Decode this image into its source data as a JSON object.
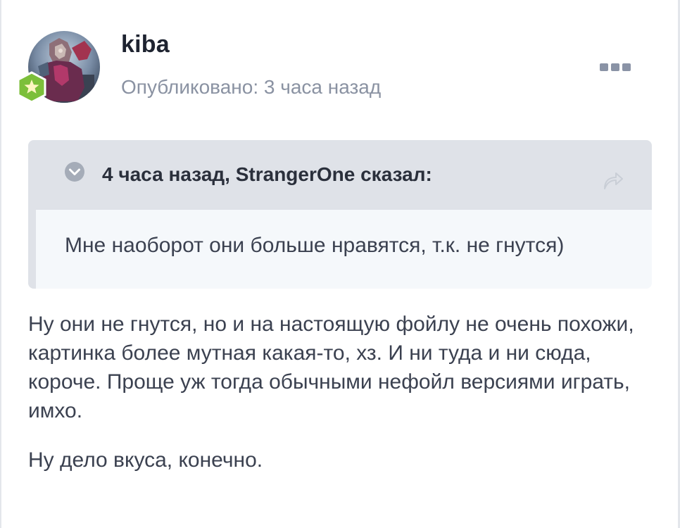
{
  "post": {
    "author": "kiba",
    "published": "Опубликовано: 3 часа назад",
    "avatar": "author-avatar",
    "rank_badge": "star-badge-icon",
    "more": "more-options-icon"
  },
  "quote": {
    "citation": "4 часа назад, StrangerOne сказал:",
    "body": "Мне наоборот они больше нравятся, т.к. не гнутся)",
    "collapse_icon": "chevron-down-circle-icon",
    "share_icon": "share-arrow-icon"
  },
  "body": {
    "paragraphs": [
      "Ну они не гнутся, но и на настоящую фойлу не очень похожи, картинка более мутная какая-то, хз. И ни туда и ни сюда, короче. Проще уж тогда обычными нефойл версиями играть, имхо.",
      "Ну дело вкуса, конечно."
    ]
  },
  "colors": {
    "quote_header_bg": "#dfe2e8",
    "quote_body_bg": "#f5f8fb",
    "muted_text": "#8a92a2",
    "badge_green": "#7cbf3a"
  }
}
